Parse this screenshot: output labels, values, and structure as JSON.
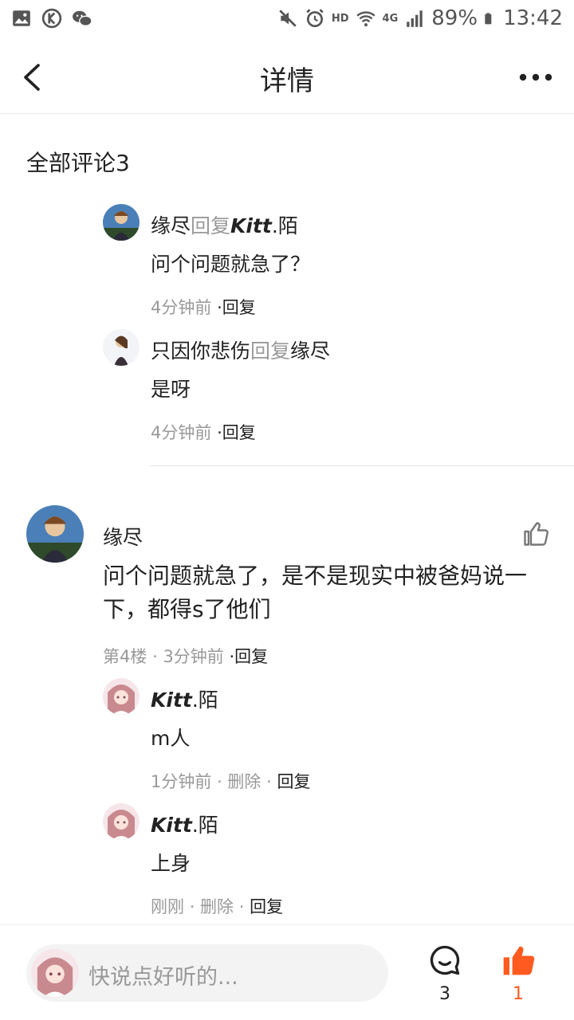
{
  "status_bar": {
    "battery": "89%",
    "time": "13:42",
    "network_badge": "HD",
    "net_gen": "4G",
    "left_icons": [
      "gallery-icon",
      "k-app-icon",
      "wechat-icon"
    ],
    "right_icons": [
      "mute-icon",
      "alarm-icon",
      "wifi-icon",
      "signal-icon",
      "battery-icon"
    ]
  },
  "header": {
    "title": "详情"
  },
  "comments_section": {
    "title": "全部评论3"
  },
  "replies_top": [
    {
      "author": "缘尽",
      "reply_word": "回复",
      "target": "Kitt",
      "target_suffix": ".陌",
      "text": "问个问题就急了？",
      "time": "4分钟前",
      "action": "·回复"
    },
    {
      "author": "只因你悲伤",
      "reply_word": "回复",
      "target": "缘尽",
      "text": "是呀",
      "time": "4分钟前",
      "action": "·回复"
    }
  ],
  "main_comment": {
    "author": "缘尽",
    "text": "问个问题就急了，是不是现实中被爸妈说一下，都得s了他们",
    "floor": "第4楼",
    "sep": "·",
    "time": "3分钟前",
    "action": "·回复"
  },
  "sub_replies": [
    {
      "author_bold": "Kitt",
      "author_suffix": ".陌",
      "text": "m人",
      "time": "1分钟前",
      "delete": "· 删除 ·",
      "action": "回复"
    },
    {
      "author_bold": "Kitt",
      "author_suffix": ".陌",
      "text": "上身",
      "time": "刚刚",
      "delete": "· 删除 ·",
      "action": "回复"
    }
  ],
  "bottom_bar": {
    "placeholder": "快说点好听的...",
    "comment_count": "3",
    "like_count": "1"
  },
  "colors": {
    "accent": "#ff5a1f",
    "muted_text": "#999999",
    "divider": "#e5e5e5"
  }
}
